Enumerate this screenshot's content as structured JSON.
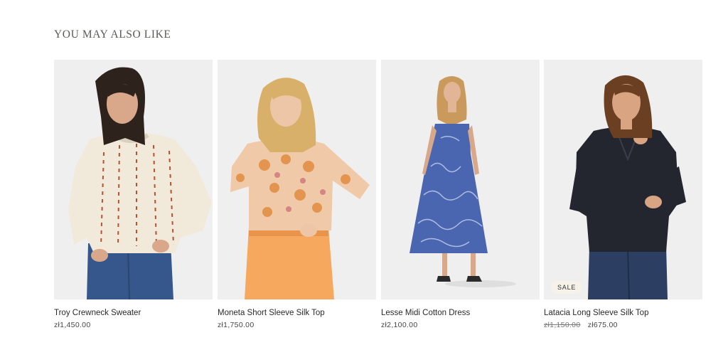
{
  "section": {
    "title": "YOU MAY ALSO LIKE"
  },
  "colors": {
    "card_background": "#efefef",
    "sale_badge_background": "#f6f2ea",
    "text": "#2a2a2a"
  },
  "products": [
    {
      "name": "Troy Crewneck Sweater",
      "price": "zł1,450.00",
      "badge": "",
      "image": "model-cream-knit-sweater"
    },
    {
      "name": "Moneta Short Sleeve Silk Top",
      "price": "zł1,750.00",
      "badge": "",
      "image": "model-floral-silk-top"
    },
    {
      "name": "Lesse Midi Cotton Dress",
      "price": "zł2,100.00",
      "badge": "",
      "image": "model-blue-print-dress"
    },
    {
      "name": "Latacia Long Sleeve Silk Top",
      "old_price": "zł1,150.00",
      "price": "zł675.00",
      "badge": "SALE",
      "image": "model-navy-silk-blouse"
    }
  ]
}
